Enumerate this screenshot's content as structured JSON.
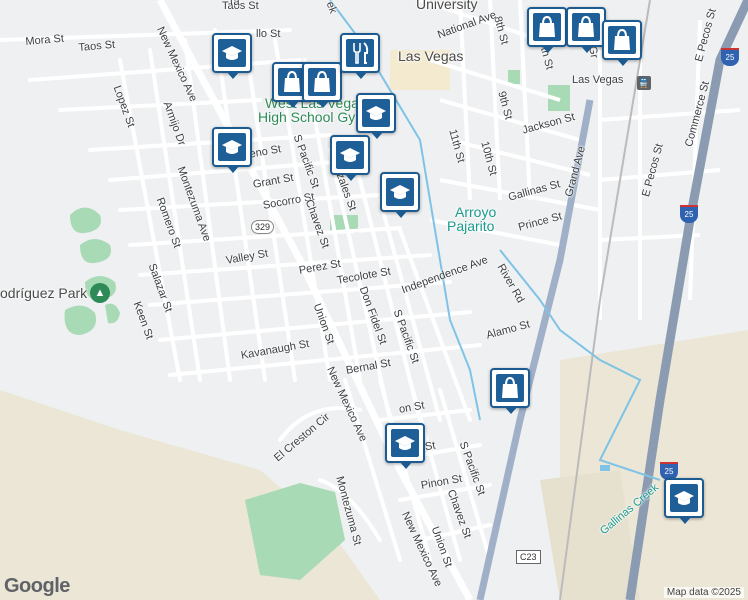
{
  "map": {
    "streets": [
      {
        "id": "taos",
        "text": "Taos St"
      },
      {
        "id": "mora",
        "text": "Mora St"
      },
      {
        "id": "taos_top",
        "text": "Taos St"
      },
      {
        "id": "lopez",
        "text": "Lopez St"
      },
      {
        "id": "armijo",
        "text": "Armijo Dr"
      },
      {
        "id": "nm_ave_top",
        "text": "New Mexico Ave"
      },
      {
        "id": "montezuma_ave",
        "text": "Montezuma Ave"
      },
      {
        "id": "romero",
        "text": "Romero St"
      },
      {
        "id": "salazar",
        "text": "Salazar St"
      },
      {
        "id": "keen",
        "text": "Keen St"
      },
      {
        "id": "moreno",
        "text": "Moreno St"
      },
      {
        "id": "grant",
        "text": "Grant St"
      },
      {
        "id": "socorro",
        "text": "Socorro St"
      },
      {
        "id": "valley",
        "text": "Valley St"
      },
      {
        "id": "pacific_n",
        "text": "S Pacific St"
      },
      {
        "id": "chavez_n",
        "text": "Chavez St"
      },
      {
        "id": "gonzales",
        "text": "Gonzales St"
      },
      {
        "id": "perez",
        "text": "Perez St"
      },
      {
        "id": "tecolote",
        "text": "Tecolote St"
      },
      {
        "id": "don_fidel",
        "text": "Don Fidel St"
      },
      {
        "id": "pacific_mid",
        "text": "S Pacific St"
      },
      {
        "id": "union_n",
        "text": "Union St"
      },
      {
        "id": "kavanaugh",
        "text": "Kavanaugh St"
      },
      {
        "id": "bernal",
        "text": "Bernal St"
      },
      {
        "id": "nm_ave_mid",
        "text": "New Mexico Ave"
      },
      {
        "id": "el_creston",
        "text": "El Creston Cir"
      },
      {
        "id": "montezuma_st",
        "text": "Montezuma St"
      },
      {
        "id": "pinon",
        "text": "Pinon St"
      },
      {
        "id": "chavez_s",
        "text": "Chavez St"
      },
      {
        "id": "union_s",
        "text": "Union St"
      },
      {
        "id": "nm_ave_s",
        "text": "New Mexico Ave"
      },
      {
        "id": "pacific_s",
        "text": "S Pacific St"
      },
      {
        "id": "independence",
        "text": "Independence Ave"
      },
      {
        "id": "alamo",
        "text": "Alamo St"
      },
      {
        "id": "river_rd",
        "text": "River Rd"
      },
      {
        "id": "prince",
        "text": "Prince St"
      },
      {
        "id": "gallinas",
        "text": "Gallinas St"
      },
      {
        "id": "jackson",
        "text": "Jackson St"
      },
      {
        "id": "eleventh",
        "text": "11th St"
      },
      {
        "id": "tenth",
        "text": "10th St"
      },
      {
        "id": "ninth",
        "text": "9th St"
      },
      {
        "id": "eighth",
        "text": "8th St"
      },
      {
        "id": "national",
        "text": "National Ave"
      },
      {
        "id": "grand",
        "text": "Grand Ave"
      },
      {
        "id": "e_pecos",
        "text": "E Pecos St"
      },
      {
        "id": "commerce",
        "text": "Commerce St"
      },
      {
        "id": "e_pecos_n",
        "text": "E Pecos St"
      },
      {
        "id": "sixth",
        "text": "6th St"
      },
      {
        "id": "cut1",
        "text": "llo St"
      },
      {
        "id": "cut2",
        "text": "on St"
      },
      {
        "id": "cut3",
        "text": "a St"
      },
      {
        "id": "cut4",
        "text": "Gr"
      },
      {
        "id": "cut5",
        "text": "Ta"
      },
      {
        "id": "cut6",
        "text": "ek"
      }
    ],
    "places": [
      {
        "id": "las_vegas",
        "text": "Las Vegas"
      },
      {
        "id": "las_vegas_station",
        "text": "Las Vegas"
      },
      {
        "id": "university",
        "text": "University"
      },
      {
        "id": "whs_line1",
        "text": "West Las Vegas"
      },
      {
        "id": "whs_line2",
        "text": "High School Gym"
      },
      {
        "id": "arroyo1",
        "text": "Arroyo"
      },
      {
        "id": "arroyo2",
        "text": "Pajarito"
      },
      {
        "id": "rodriguez",
        "text": "odríguez Park"
      },
      {
        "id": "gallinas_creek",
        "text": "Gallinas Creek"
      }
    ],
    "shields": {
      "nm329": "329",
      "c23": "C23",
      "i25_n": "25",
      "i25_mid": "25",
      "i25_s": "25"
    },
    "markers": [
      {
        "name": "school-marker",
        "icon": "graduation-cap-icon"
      },
      {
        "name": "school-marker",
        "icon": "graduation-cap-icon"
      },
      {
        "name": "school-marker",
        "icon": "graduation-cap-icon"
      },
      {
        "name": "school-marker",
        "icon": "graduation-cap-icon"
      },
      {
        "name": "school-marker",
        "icon": "graduation-cap-icon"
      },
      {
        "name": "school-marker",
        "icon": "graduation-cap-icon"
      },
      {
        "name": "school-marker",
        "icon": "graduation-cap-icon"
      },
      {
        "name": "shopping-marker",
        "icon": "shopping-bag-icon"
      },
      {
        "name": "shopping-marker",
        "icon": "shopping-bag-icon"
      },
      {
        "name": "shopping-marker",
        "icon": "shopping-bag-icon"
      },
      {
        "name": "shopping-marker",
        "icon": "shopping-bag-icon"
      },
      {
        "name": "shopping-marker",
        "icon": "shopping-bag-icon"
      },
      {
        "name": "shopping-marker",
        "icon": "shopping-bag-icon"
      },
      {
        "name": "restaurant-marker",
        "icon": "fork-knife-icon"
      }
    ],
    "attribution": "Map data ©2025",
    "logo": "Google",
    "colors": {
      "marker": "#1f5f98",
      "park": "#a8dab5",
      "creek": "#7fc3e6",
      "highway": "#8a9bb2"
    }
  }
}
